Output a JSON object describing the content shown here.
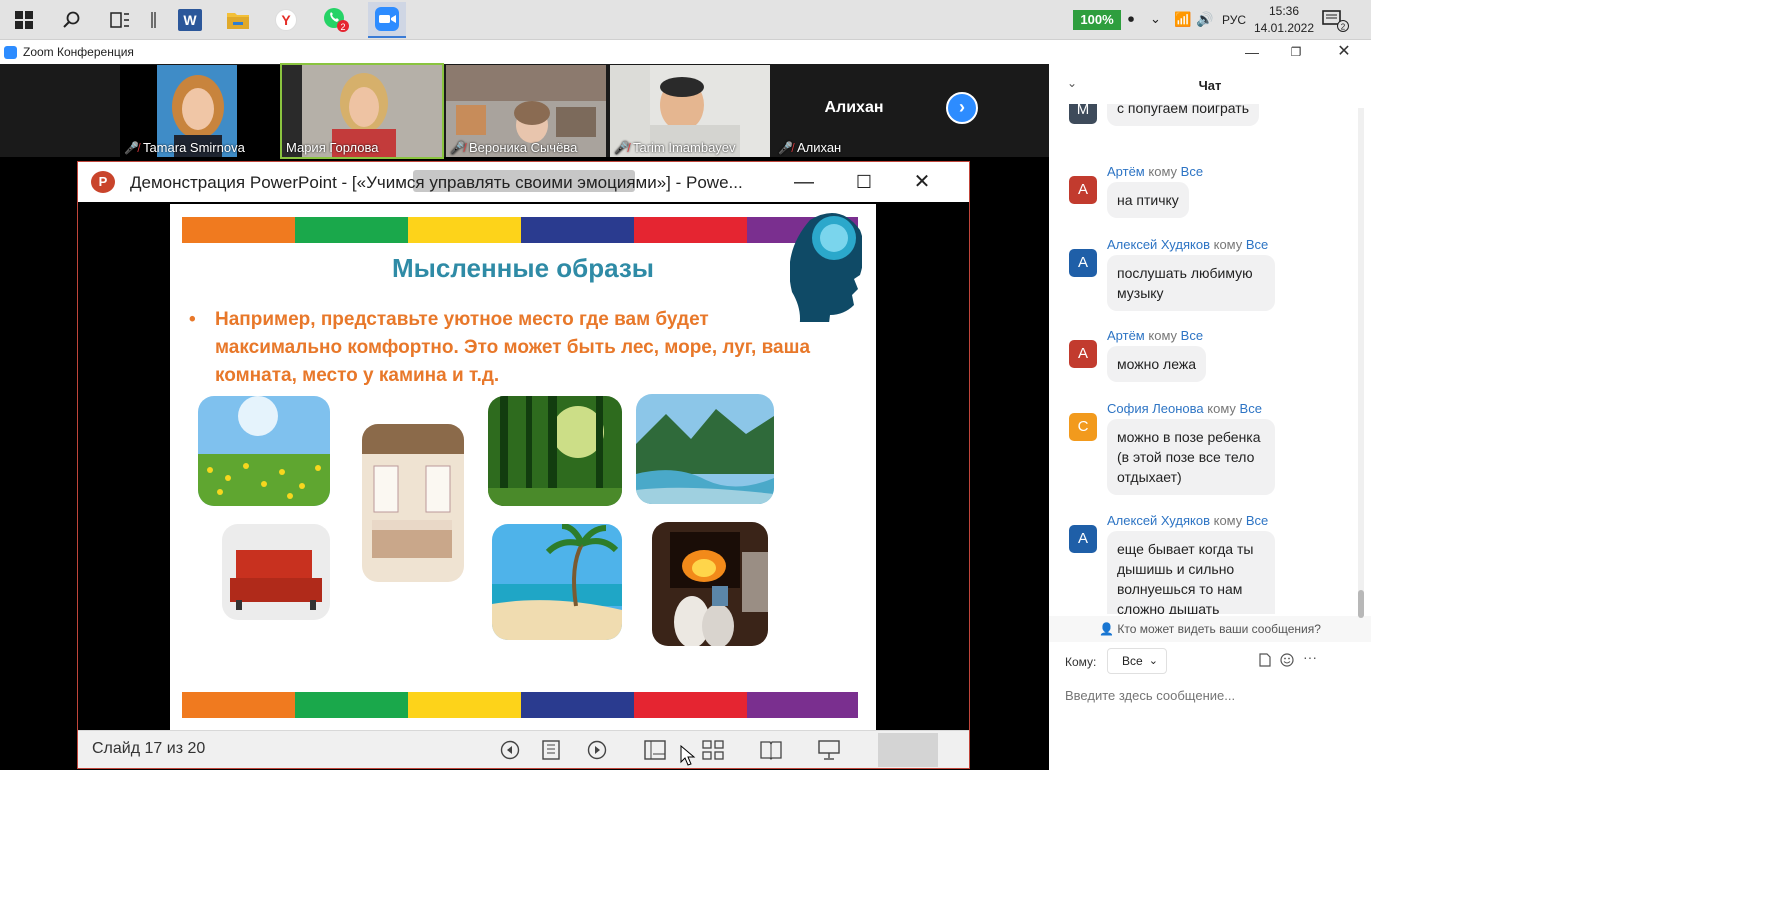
{
  "taskbar": {
    "icons": [
      "windows-start",
      "search",
      "task-view",
      "word",
      "file-explorer",
      "yandex-browser",
      "whatsapp",
      "zoom"
    ],
    "whatsapp_badge": "2",
    "battery": "100%",
    "language": "РУС",
    "time": "15:36",
    "date": "14.01.2022",
    "notifications_badge": "2"
  },
  "zoom": {
    "window_title": "Zoom Конференция",
    "participants": [
      {
        "name": "Tamara Smirnova",
        "muted": true
      },
      {
        "name": "Мария Горлова",
        "muted": false,
        "speaking": true
      },
      {
        "name": "Вероника Сычёва",
        "muted": true
      },
      {
        "name": "Tarim Imambayev",
        "muted": true
      },
      {
        "name": "Алихан",
        "muted": true,
        "video_off": true
      }
    ]
  },
  "powerpoint": {
    "window_title": "Демонстрация PowerPoint - [«Учимся управлять своими эмоциями»] - Powe...",
    "logo": "P",
    "slide": {
      "title": "Мысленные образы",
      "bullet": "Например, представьте уютное место где вам будет максимально комфортно. Это может быть лес, море, луг, ваша комната, место у камина и т.д.",
      "photos": [
        "meadow",
        "bedroom",
        "forest",
        "mountain-river",
        "red-sofa",
        "tropical-beach",
        "fireplace"
      ],
      "rainbow": [
        "#f07a1f",
        "#1aa84b",
        "#fdd31a",
        "#2a3b8f",
        "#e52531",
        "#7a2f8f"
      ]
    },
    "status": "Слайд 17 из 20"
  },
  "chat": {
    "title": "Чат",
    "messages": [
      {
        "avatar": "М",
        "color": "#3e4b5b",
        "text": "с попугаем поиграть",
        "sender": "",
        "to": "",
        "all": ""
      },
      {
        "avatar": "А",
        "color": "#c23b2e",
        "sender": "Артём",
        "to": "кому",
        "all": "Все",
        "text": "на птичку"
      },
      {
        "avatar": "А",
        "color": "#1f5fa8",
        "sender": "Алексей Худяков",
        "to": "кому",
        "all": "Все",
        "text": "послушать любимую музыку"
      },
      {
        "avatar": "А",
        "color": "#c23b2e",
        "sender": "Артём",
        "to": "кому",
        "all": "Все",
        "text": "можно лежа"
      },
      {
        "avatar": "С",
        "color": "#f29a1d",
        "sender": "София Леонова",
        "to": "кому",
        "all": "Все",
        "text": "можно в позе ребенка (в этой позе все тело отдыхает)"
      },
      {
        "avatar": "А",
        "color": "#1f5fa8",
        "sender": "Алексей Худяков",
        "to": "кому",
        "all": "Все",
        "text": "еще бывает когда ты дышишь и сильно волнуешься то нам сложно дышать"
      }
    ],
    "who_sees": "Кто может видеть ваши сообщения?",
    "to_label": "Кому:",
    "to_value": "Все",
    "input_placeholder": "Введите здесь сообщение..."
  }
}
